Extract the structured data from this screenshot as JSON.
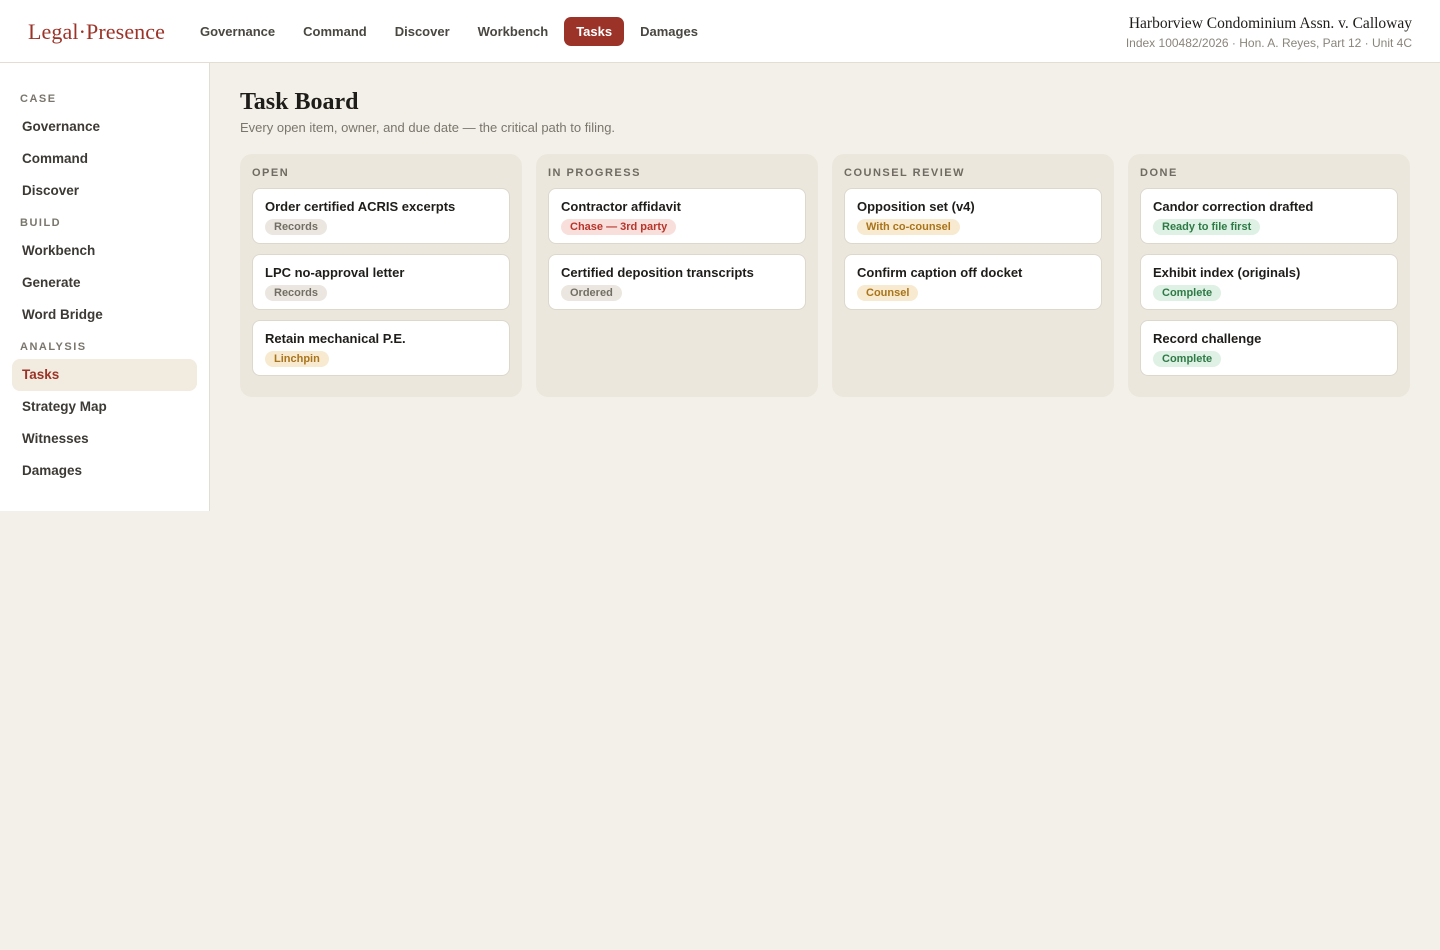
{
  "header": {
    "logo_left": "Legal",
    "logo_sep": "·",
    "logo_right": "Presence",
    "nav": [
      "Governance",
      "Command",
      "Discover",
      "Workbench",
      "Tasks",
      "Damages"
    ],
    "active_nav": "Tasks",
    "case_title": "Harborview Condominium Assn. v. Calloway",
    "case_meta": "Index 100482/2026 · Hon. A. Reyes, Part 12 · Unit 4C"
  },
  "sidebar": {
    "sections": [
      {
        "label": "CASE",
        "items": [
          "Governance",
          "Command",
          "Discover"
        ]
      },
      {
        "label": "BUILD",
        "items": [
          "Workbench",
          "Generate",
          "Word Bridge"
        ]
      },
      {
        "label": "ANALYSIS",
        "items": [
          "Tasks",
          "Strategy Map",
          "Witnesses",
          "Damages"
        ]
      }
    ],
    "active_item": "Tasks"
  },
  "main": {
    "title": "Task Board",
    "subtitle": "Every open item, owner, and due date — the critical path to filing.",
    "columns": [
      {
        "label": "OPEN",
        "cards": [
          {
            "title": "Order certified ACRIS excerpts",
            "badge": "Records",
            "badge_color": "gray"
          },
          {
            "title": "LPC no-approval letter",
            "badge": "Records",
            "badge_color": "gray"
          },
          {
            "title": "Retain mechanical P.E.",
            "badge": "Linchpin",
            "badge_color": "amber"
          }
        ]
      },
      {
        "label": "IN PROGRESS",
        "cards": [
          {
            "title": "Contractor affidavit",
            "badge": "Chase — 3rd party",
            "badge_color": "red"
          },
          {
            "title": "Certified deposition transcripts",
            "badge": "Ordered",
            "badge_color": "gray"
          }
        ]
      },
      {
        "label": "COUNSEL REVIEW",
        "cards": [
          {
            "title": "Opposition set (v4)",
            "badge": "With co-counsel",
            "badge_color": "amber"
          },
          {
            "title": "Confirm caption off docket",
            "badge": "Counsel",
            "badge_color": "amber"
          }
        ]
      },
      {
        "label": "DONE",
        "cards": [
          {
            "title": "Candor correction drafted",
            "badge": "Ready to file first",
            "badge_color": "green"
          },
          {
            "title": "Exhibit index (originals)",
            "badge": "Complete",
            "badge_color": "green"
          },
          {
            "title": "Record challenge",
            "badge": "Complete",
            "badge_color": "green"
          }
        ]
      }
    ]
  },
  "colors": {
    "brand": "#9b3328",
    "background": "#f3f0e9",
    "badge_gray": "#ebe7e0",
    "badge_red": "#f8dfdc",
    "badge_amber": "#f8ead0",
    "badge_green": "#dff1e4"
  }
}
